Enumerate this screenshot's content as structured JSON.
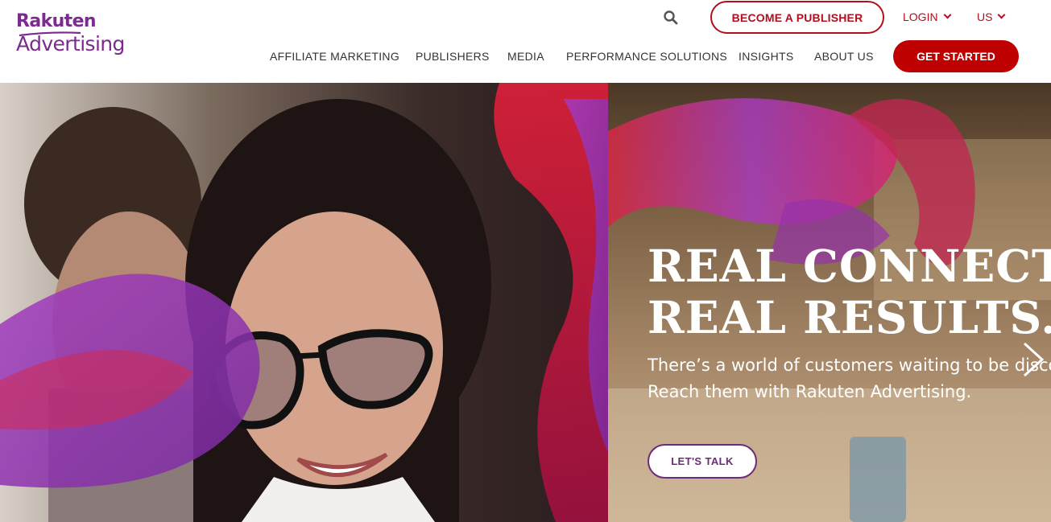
{
  "logo": {
    "line1": "Rakuten",
    "line2": "Advertising"
  },
  "header": {
    "search_icon": "search-icon",
    "become_publisher": "BECOME A PUBLISHER",
    "login": "LOGIN",
    "region": "US",
    "get_started": "GET STARTED"
  },
  "nav": {
    "items": [
      {
        "label": "AFFILIATE MARKETING"
      },
      {
        "label": "PUBLISHERS"
      },
      {
        "label": "MEDIA"
      },
      {
        "label": "PERFORMANCE SOLUTIONS"
      },
      {
        "label": "INSIGHTS"
      },
      {
        "label": "ABOUT US"
      }
    ]
  },
  "hero": {
    "title_line1": "REAL CONNECTIONS.",
    "title_line2": "REAL RESULTS.",
    "sub_line1": "There’s a world of customers waiting to be discovered.",
    "sub_line2": "Reach them with Rakuten Advertising.",
    "cta": "LET'S TALK",
    "next_icon": "chevron-right-icon"
  },
  "colors": {
    "brand_purple": "#7b2b8f",
    "brand_red": "#bf0000",
    "outline_red": "#b0101e",
    "cta_purple": "#6d2a7a"
  }
}
